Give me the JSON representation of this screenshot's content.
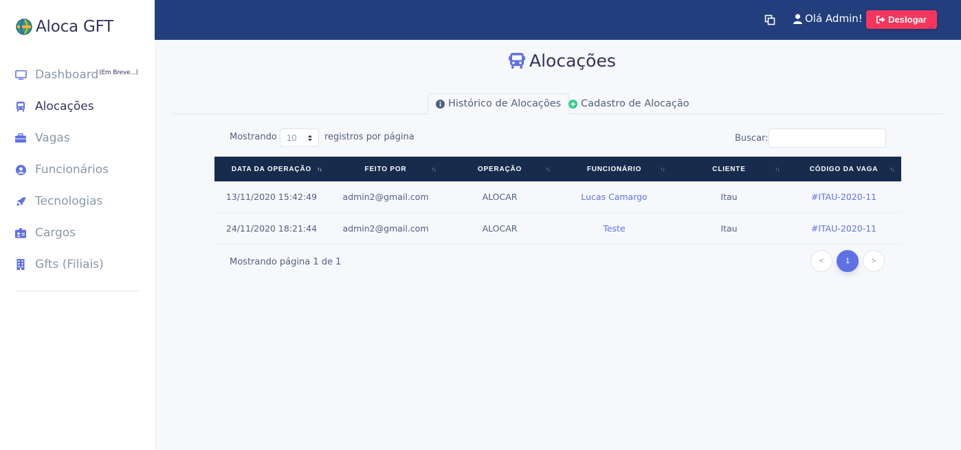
{
  "app": {
    "brand": "Aloca GFT"
  },
  "sidebar": {
    "items": [
      {
        "label": "Dashboard",
        "badge": "(Em Breve...)",
        "icon": "monitor-icon"
      },
      {
        "label": "Alocações",
        "icon": "bus-icon"
      },
      {
        "label": "Vagas",
        "icon": "briefcase-icon"
      },
      {
        "label": "Funcionários",
        "icon": "user-circle-icon"
      },
      {
        "label": "Tecnologias",
        "icon": "rocket-icon"
      },
      {
        "label": "Cargos",
        "icon": "id-badge-icon"
      },
      {
        "label": "Gfts (Filiais)",
        "icon": "building-icon"
      }
    ]
  },
  "topbar": {
    "greeting": "Olá Admin!",
    "logout_label": "Deslogar"
  },
  "page": {
    "title": "Alocações"
  },
  "tabs": [
    {
      "label": "Histórico de Alocações",
      "icon": "info-circle-icon"
    },
    {
      "label": "Cadastro de Alocação",
      "icon": "plus-circle-icon"
    }
  ],
  "controls": {
    "show_prefix": "Mostrando",
    "page_size": "10",
    "show_suffix": "registros por página",
    "search_label": "Buscar:",
    "search_value": ""
  },
  "table": {
    "headers": [
      "DATA DA OPERAÇÃO",
      "FEITO POR",
      "OPERAÇÃO",
      "FUNCIONÁRIO",
      "CLIENTE",
      "CÓDIGO DA VAGA"
    ],
    "rows": [
      [
        "13/11/2020 15:42:49",
        "admin2@gmail.com",
        "ALOCAR",
        "Lucas Camargo",
        "Itau",
        "#ITAU-2020-11"
      ],
      [
        "24/11/2020 18:21:44",
        "admin2@gmail.com",
        "ALOCAR",
        "Teste",
        "Itau",
        "#ITAU-2020-11"
      ]
    ]
  },
  "footer": {
    "info": "Mostrando página 1 de 1",
    "prev": "<",
    "current_page": "1",
    "next": ">"
  },
  "colors": {
    "topbar": "#223e7c",
    "table_header": "#172b4d",
    "accent": "#5e72e4",
    "danger": "#f5365c"
  }
}
